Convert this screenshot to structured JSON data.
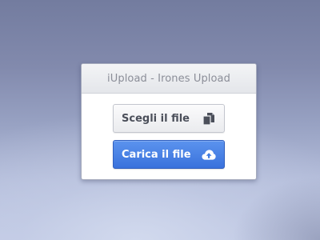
{
  "dialog": {
    "title": "iUpload - Irones Upload"
  },
  "buttons": {
    "choose_file": {
      "label": "Scegli il file",
      "icon": "copy-icon"
    },
    "upload_file": {
      "label": "Carica il file",
      "icon": "cloud-upload-icon"
    }
  },
  "colors": {
    "primary": "#3f7ae0",
    "secondary": "#eef0f3",
    "title_text": "#8b8e98"
  }
}
